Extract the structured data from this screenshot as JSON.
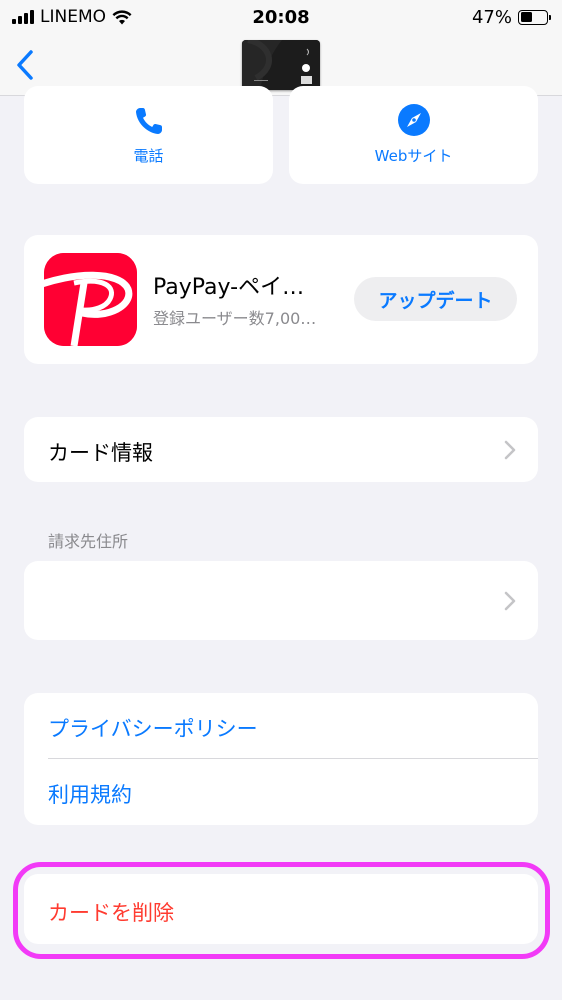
{
  "status_bar": {
    "carrier": "LINEMO",
    "time": "20:08",
    "battery": "47%",
    "battery_level": 0.47,
    "signal_icon": "cellular-signal-icon",
    "wifi_icon": "wifi-icon"
  },
  "nav": {
    "back_icon": "chevron-left-icon",
    "card_thumbnail": "paypay-card-image"
  },
  "actions": {
    "phone_label": "電話",
    "website_label": "Webサイト"
  },
  "app": {
    "name": "PayPay-ペイ…",
    "subtitle": "登録ユーザー数7,00…",
    "update_label": "アップデート"
  },
  "rows": {
    "card_info_label": "カード情報",
    "billing_header": "請求先住所",
    "billing_value": ""
  },
  "links": {
    "privacy_label": "プライバシーポリシー",
    "terms_label": "利用規約"
  },
  "delete": {
    "label": "カードを削除"
  },
  "colors": {
    "accent": "#0a7aff",
    "destructive": "#ff3b30",
    "highlight": "#f23af7",
    "background": "#f2f2f7"
  }
}
